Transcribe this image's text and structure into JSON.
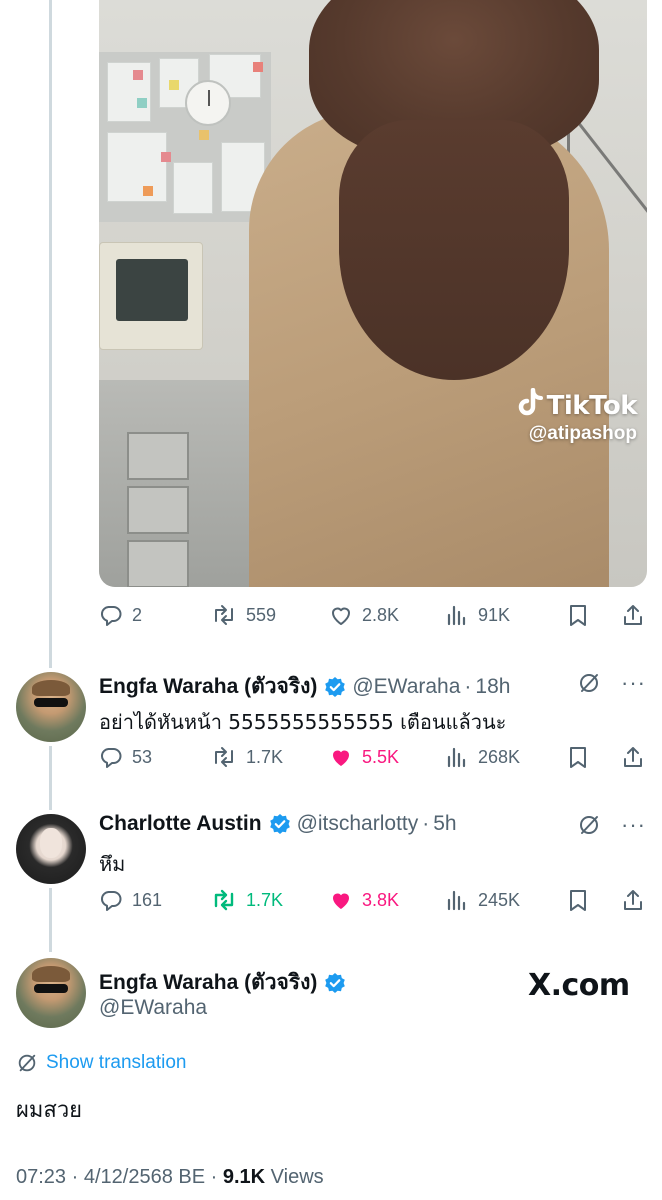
{
  "media": {
    "watermark_brand": "TikTok",
    "watermark_handle": "@atipashop"
  },
  "first_actions": {
    "replies": "2",
    "reposts": "559",
    "likes": "2.8K",
    "views": "91K"
  },
  "replies": [
    {
      "name": "Engfa Waraha (ตัวจริง)",
      "handle": "@EWaraha",
      "time": "18h",
      "text": "อย่าได้หันหน้า 5555555555555 เตือนแล้วนะ",
      "replies": "53",
      "reposts": "1.7K",
      "likes": "5.5K",
      "views": "268K",
      "liked": true,
      "reposted": false
    },
    {
      "name": "Charlotte Austin",
      "handle": "@itscharlotty",
      "time": "5h",
      "text": "หึม",
      "replies": "161",
      "reposts": "1.7K",
      "likes": "3.8K",
      "views": "245K",
      "liked": true,
      "reposted": true
    }
  ],
  "main": {
    "name": "Engfa Waraha (ตัวจริง)",
    "handle": "@EWaraha",
    "overlay_logo": "X.com",
    "translate_label": "Show translation",
    "text": "ผมสวย",
    "time": "07:23",
    "date": "4/12/2568 BE",
    "views_count": "9.1K",
    "views_label": "Views"
  },
  "colors": {
    "accent": "#1d9bf0",
    "like": "#f91880",
    "repost": "#00ba7c",
    "secondary": "#536471"
  },
  "icons": [
    "reply-icon",
    "repost-icon",
    "like-icon",
    "views-icon",
    "bookmark-icon",
    "share-icon",
    "verified-badge-icon",
    "grok-icon",
    "more-icon",
    "translate-icon"
  ]
}
